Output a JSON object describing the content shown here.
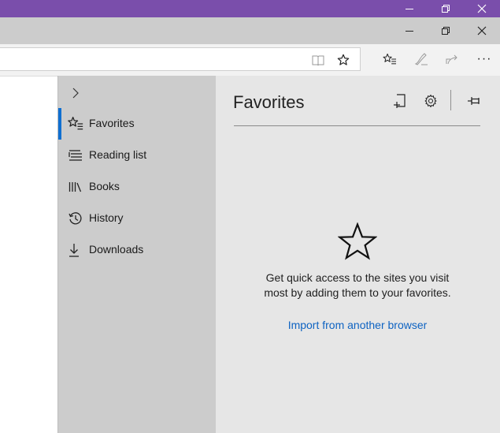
{
  "hub": {
    "items": [
      {
        "label": "Favorites",
        "icon": "favorites-icon"
      },
      {
        "label": "Reading list",
        "icon": "reading-list-icon"
      },
      {
        "label": "Books",
        "icon": "books-icon"
      },
      {
        "label": "History",
        "icon": "history-icon"
      },
      {
        "label": "Downloads",
        "icon": "download-icon"
      }
    ],
    "selected_index": 0
  },
  "favorites_pane": {
    "title": "Favorites",
    "empty_message": "Get quick access to the sites you visit most by adding them to your favorites.",
    "import_link": "Import from another browser"
  },
  "toolbar": {
    "more_label": "···"
  },
  "colors": {
    "outer_titlebar": "#7a4eab",
    "inner_titlebar": "#cccccc",
    "hub_nav": "#cccccc",
    "pane": "#e6e6e6",
    "accent": "#0f6fd1",
    "link": "#0e63c2"
  }
}
